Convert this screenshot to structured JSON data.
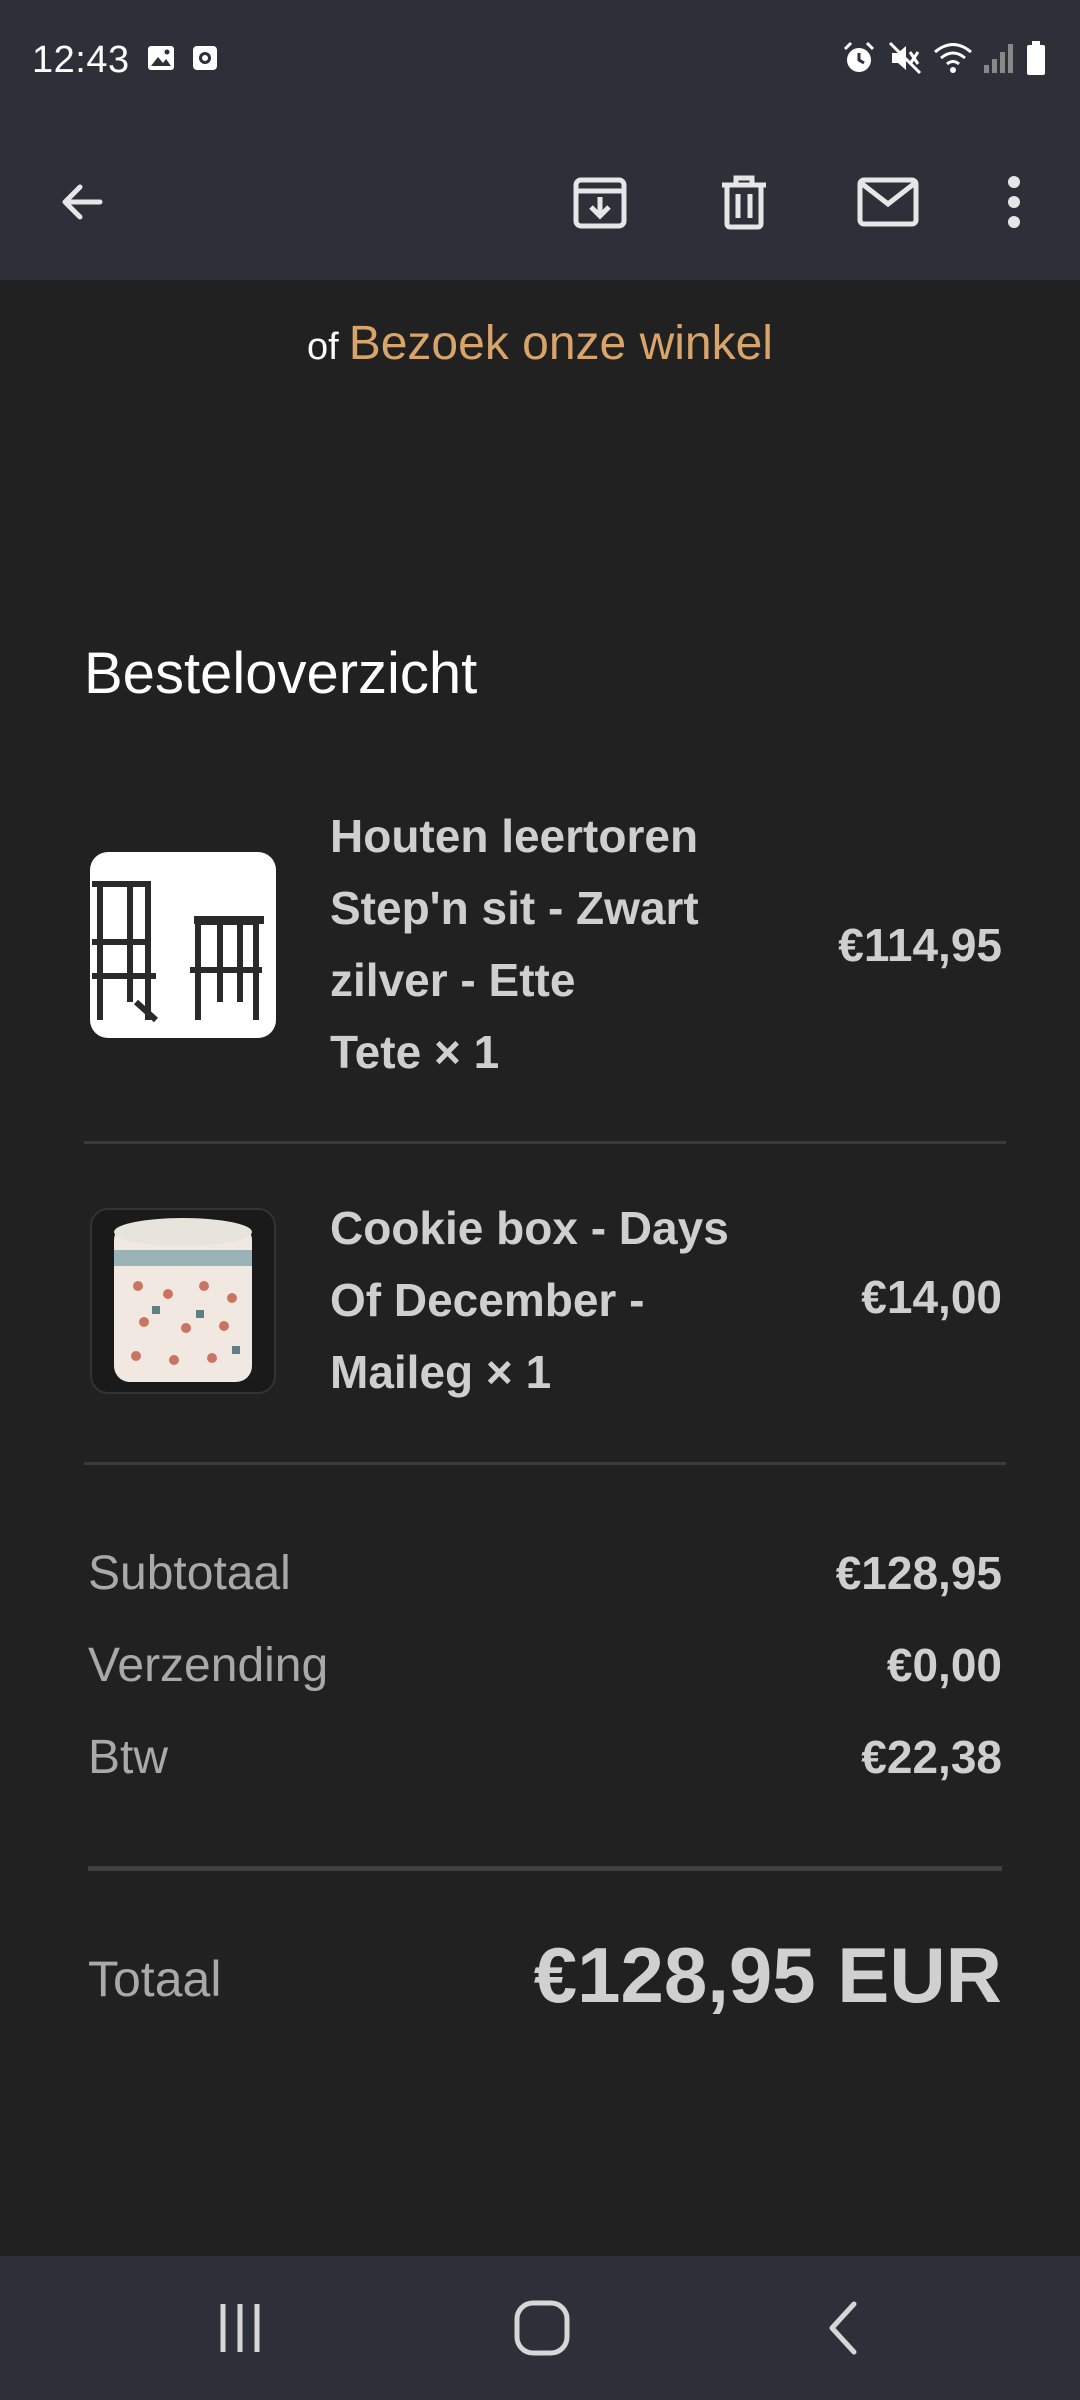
{
  "status_bar": {
    "time": "12:43",
    "left_icons": [
      "image-icon",
      "camera-icon"
    ],
    "right_icons": [
      "alarm-icon",
      "mute-icon",
      "wifi-icon",
      "signal-icon",
      "battery-icon"
    ]
  },
  "app_bar": {
    "icons": [
      "back-arrow-icon",
      "archive-icon",
      "delete-icon",
      "mail-icon",
      "more-vert-icon"
    ]
  },
  "email": {
    "visit_prefix": "of",
    "visit_link": "Bezoek onze winkel",
    "section_title": "Besteloverzicht",
    "items": [
      {
        "title_lines": [
          "Houten leertoren",
          "Step'n sit - Zwart",
          "zilver - Ette",
          "Tete × 1"
        ],
        "price": "€114,95"
      },
      {
        "title_lines": [
          "Cookie box - Days",
          "Of December -",
          "Maileg × 1"
        ],
        "price": "€14,00"
      }
    ],
    "summary": [
      {
        "label": "Subtotaal",
        "value": "€128,95"
      },
      {
        "label": "Verzending",
        "value": "€0,00"
      },
      {
        "label": "Btw",
        "value": "€22,38"
      }
    ],
    "total_label": "Totaal",
    "total_value": "€128,95 EUR"
  },
  "colors": {
    "bar_background": "#2d3038",
    "page_background": "#212121",
    "link_accent": "#d9a469"
  },
  "nav_bar": {
    "icons": [
      "recents-icon",
      "home-icon",
      "back-icon"
    ]
  }
}
